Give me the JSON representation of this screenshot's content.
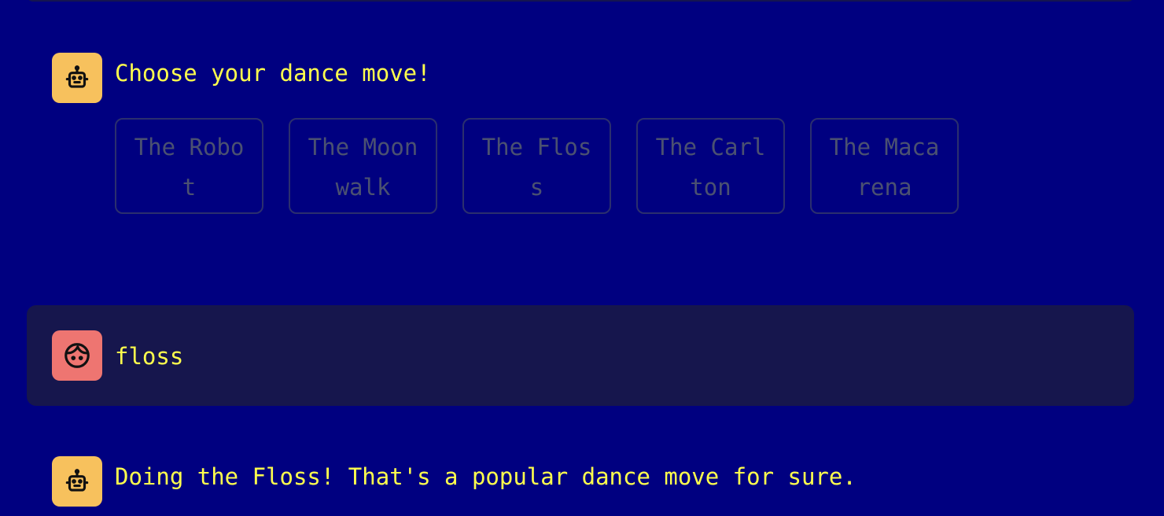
{
  "messages": {
    "bot_prompt": "Choose your dance move!",
    "user_reply": "floss",
    "bot_response": "Doing the Floss! That's a popular dance move for sure."
  },
  "choices": [
    {
      "label": "The Robot"
    },
    {
      "label": "The Moonwalk"
    },
    {
      "label": "The Floss"
    },
    {
      "label": "The Carlton"
    },
    {
      "label": "The Macarena"
    }
  ],
  "icons": {
    "bot": "robot-icon",
    "user": "face-icon"
  },
  "colors": {
    "background": "#000080",
    "text": "#ffff4d",
    "bot_avatar": "#f7c15d",
    "user_avatar": "#ee7571",
    "user_row": "#16164d",
    "disabled_button_text": "#4b5171"
  }
}
